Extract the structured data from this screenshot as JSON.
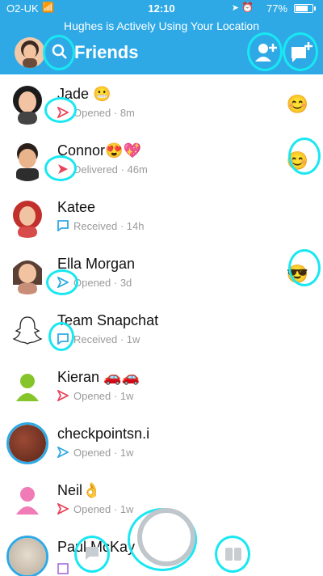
{
  "status_bar": {
    "carrier": "O2-UK",
    "time": "12:10",
    "battery": "77%",
    "battery_level": 0.77
  },
  "banner": {
    "text": "Hughes is Actively Using Your Location"
  },
  "header": {
    "title": "Friends"
  },
  "friends": [
    {
      "name": "Jade 😬",
      "status_icon": "sent-arrow-outline",
      "status_color": "#e8445a",
      "status": "Opened",
      "time": "8m",
      "right_emoji": "😊"
    },
    {
      "name": "Connor😍💖",
      "status_icon": "sent-arrow-filled",
      "status_color": "#e8445a",
      "status": "Delivered",
      "time": "46m",
      "right_emoji": "😊"
    },
    {
      "name": "Katee",
      "status_icon": "chat-bubble-outline",
      "status_color": "#2ea9e6",
      "status": "Received",
      "time": "14h",
      "right_emoji": ""
    },
    {
      "name": "Ella Morgan",
      "status_icon": "sent-arrow-outline",
      "status_color": "#2ea9e6",
      "status": "Opened",
      "time": "3d",
      "right_emoji": "😎"
    },
    {
      "name": "Team Snapchat",
      "status_icon": "chat-bubble-outline",
      "status_color": "#2ea9e6",
      "status": "Received",
      "time": "1w",
      "right_emoji": ""
    },
    {
      "name": "Kieran 🚗🚗",
      "status_icon": "sent-arrow-outline",
      "status_color": "#e8445a",
      "status": "Opened",
      "time": "1w",
      "right_emoji": ""
    },
    {
      "name": "checkpointsn.i",
      "status_icon": "sent-arrow-outline",
      "status_color": "#2ea9e6",
      "status": "Opened",
      "time": "1w",
      "right_emoji": ""
    },
    {
      "name": "Neil👌",
      "status_icon": "sent-arrow-outline",
      "status_color": "#e8445a",
      "status": "Opened",
      "time": "1w",
      "right_emoji": ""
    },
    {
      "name": "Paul McKay",
      "status_icon": "square-outline",
      "status_color": "#a36bdb",
      "status": "",
      "time": "",
      "right_emoji": ""
    }
  ],
  "colors": {
    "accent": "#2ea9e6",
    "highlight": "#19e7f2",
    "sent_red": "#e8445a"
  }
}
